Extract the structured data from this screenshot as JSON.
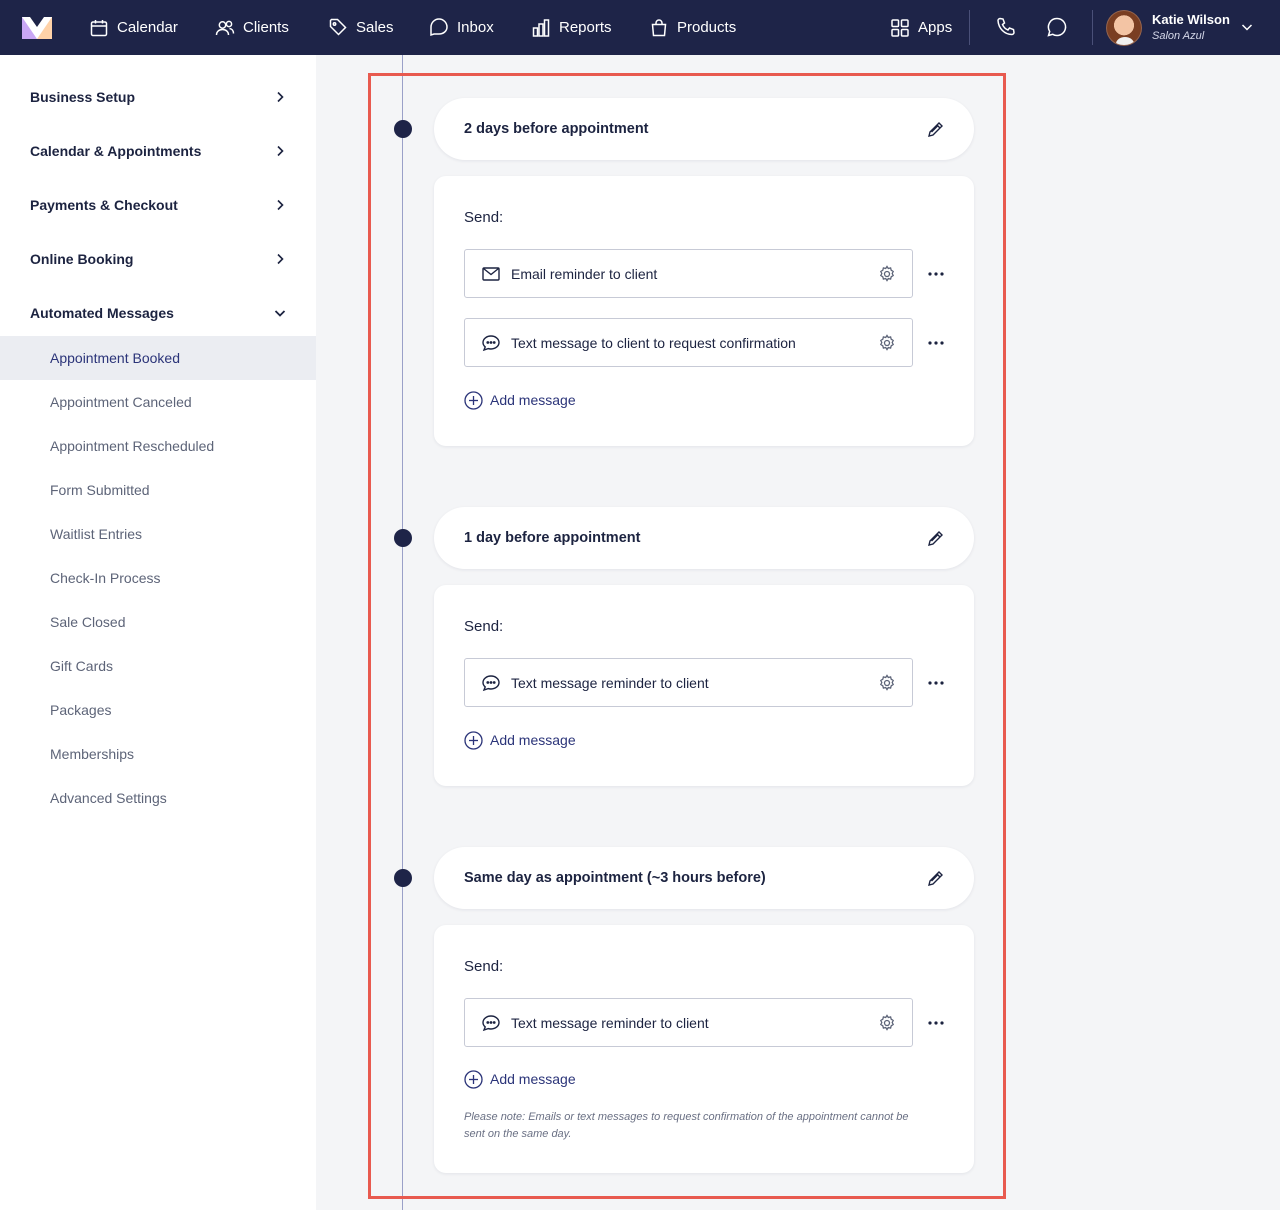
{
  "colors": {
    "nav_bg": "#1e2448",
    "accent": "#2b3479",
    "highlight": "#e85a4f",
    "timeline_dot": "#1e2448"
  },
  "topnav": {
    "items": [
      {
        "label": "Calendar",
        "icon": "calendar-icon"
      },
      {
        "label": "Clients",
        "icon": "users-icon"
      },
      {
        "label": "Sales",
        "icon": "tag-icon"
      },
      {
        "label": "Inbox",
        "icon": "inbox-icon"
      },
      {
        "label": "Reports",
        "icon": "bar-chart-icon"
      },
      {
        "label": "Products",
        "icon": "shopping-bag-icon"
      }
    ],
    "apps_label": "Apps",
    "user": {
      "name": "Katie Wilson",
      "business": "Salon Azul"
    }
  },
  "sidebar": {
    "sections": [
      {
        "label": "Business Setup",
        "expanded": false
      },
      {
        "label": "Calendar & Appointments",
        "expanded": false
      },
      {
        "label": "Payments & Checkout",
        "expanded": false
      },
      {
        "label": "Online Booking",
        "expanded": false
      },
      {
        "label": "Automated Messages",
        "expanded": true
      }
    ],
    "subitems": [
      {
        "label": "Appointment Booked",
        "active": true
      },
      {
        "label": "Appointment Canceled"
      },
      {
        "label": "Appointment Rescheduled"
      },
      {
        "label": "Form Submitted"
      },
      {
        "label": "Waitlist Entries"
      },
      {
        "label": "Check-In Process"
      },
      {
        "label": "Sale Closed"
      },
      {
        "label": "Gift Cards"
      },
      {
        "label": "Packages"
      },
      {
        "label": "Memberships"
      },
      {
        "label": "Advanced Settings"
      }
    ]
  },
  "steps": [
    {
      "title": "2 days before appointment",
      "send_label": "Send:",
      "messages": [
        {
          "label": "Email reminder to client",
          "icon": "envelope-icon"
        },
        {
          "label": "Text message to client to request confirmation",
          "icon": "chat-bubble-icon"
        }
      ],
      "add_label": "Add message"
    },
    {
      "title": "1 day before appointment",
      "send_label": "Send:",
      "messages": [
        {
          "label": "Text message reminder to client",
          "icon": "chat-bubble-icon"
        }
      ],
      "add_label": "Add message"
    },
    {
      "title": "Same day as appointment (~3 hours before)",
      "send_label": "Send:",
      "messages": [
        {
          "label": "Text message reminder to client",
          "icon": "chat-bubble-icon"
        }
      ],
      "add_label": "Add message",
      "note": "Please note: Emails or text messages to request confirmation of the appointment cannot be sent on the same day."
    }
  ]
}
